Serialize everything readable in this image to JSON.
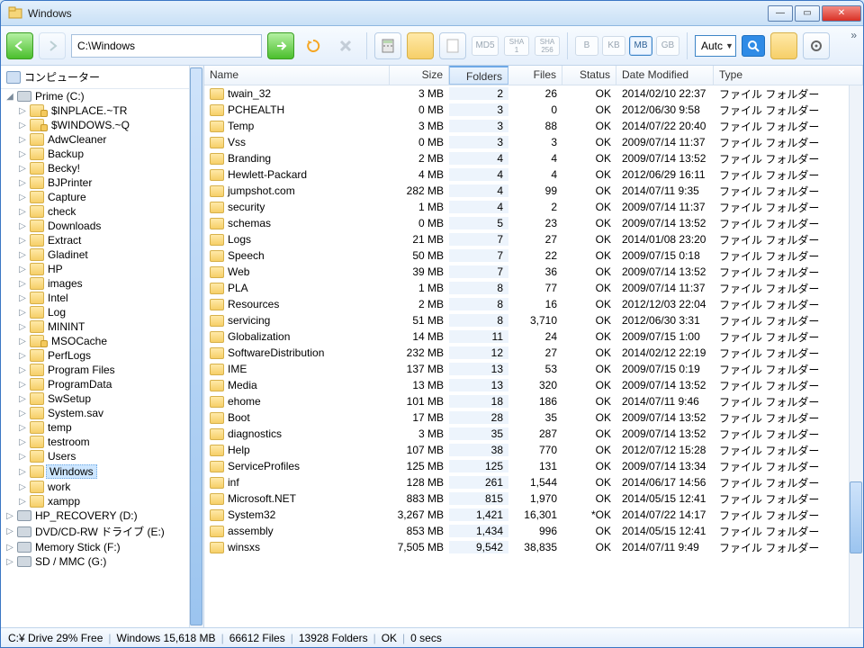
{
  "window": {
    "title": "Windows"
  },
  "toolbar": {
    "path": "C:\\Windows",
    "hash_md5": "MD5",
    "hash_sha1": "SHA\n1",
    "hash_sha256": "SHA\n256",
    "units": [
      "B",
      "KB",
      "MB",
      "GB"
    ],
    "unit_selected": 2,
    "auto": "Autc"
  },
  "tree": {
    "root": "コンピューター",
    "prime": "Prime (C:)",
    "items": [
      {
        "label": "$INPLACE.~TR",
        "locked": true
      },
      {
        "label": "$WINDOWS.~Q",
        "locked": true
      },
      {
        "label": "AdwCleaner"
      },
      {
        "label": "Backup"
      },
      {
        "label": "Becky!"
      },
      {
        "label": "BJPrinter"
      },
      {
        "label": "Capture"
      },
      {
        "label": "check"
      },
      {
        "label": "Downloads"
      },
      {
        "label": "Extract"
      },
      {
        "label": "Gladinet"
      },
      {
        "label": "HP"
      },
      {
        "label": "images"
      },
      {
        "label": "Intel"
      },
      {
        "label": "Log"
      },
      {
        "label": "MININT"
      },
      {
        "label": "MSOCache",
        "locked": true
      },
      {
        "label": "PerfLogs"
      },
      {
        "label": "Program Files"
      },
      {
        "label": "ProgramData"
      },
      {
        "label": "SwSetup"
      },
      {
        "label": "System.sav"
      },
      {
        "label": "temp"
      },
      {
        "label": "testroom"
      },
      {
        "label": "Users"
      },
      {
        "label": "Windows",
        "selected": true
      },
      {
        "label": "work"
      },
      {
        "label": "xampp"
      }
    ],
    "drives": [
      {
        "label": "HP_RECOVERY (D:)"
      },
      {
        "label": "DVD/CD-RW ドライブ (E:)"
      },
      {
        "label": "Memory Stick (F:)"
      },
      {
        "label": "SD / MMC (G:)"
      }
    ]
  },
  "columns": {
    "name": "Name",
    "size": "Size",
    "folders": "Folders",
    "files": "Files",
    "status": "Status",
    "date": "Date Modified",
    "type": "Type"
  },
  "type_label": "ファイル フォルダー",
  "rows": [
    {
      "n": "twain_32",
      "s": "3 MB",
      "fo": "2",
      "fi": "26",
      "st": "OK",
      "d": "2014/02/10 22:37"
    },
    {
      "n": "PCHEALTH",
      "s": "0 MB",
      "fo": "3",
      "fi": "0",
      "st": "OK",
      "d": "2012/06/30 9:58"
    },
    {
      "n": "Temp",
      "s": "3 MB",
      "fo": "3",
      "fi": "88",
      "st": "OK",
      "d": "2014/07/22 20:40"
    },
    {
      "n": "Vss",
      "s": "0 MB",
      "fo": "3",
      "fi": "3",
      "st": "OK",
      "d": "2009/07/14 11:37"
    },
    {
      "n": "Branding",
      "s": "2 MB",
      "fo": "4",
      "fi": "4",
      "st": "OK",
      "d": "2009/07/14 13:52"
    },
    {
      "n": "Hewlett-Packard",
      "s": "4 MB",
      "fo": "4",
      "fi": "4",
      "st": "OK",
      "d": "2012/06/29 16:11"
    },
    {
      "n": "jumpshot.com",
      "s": "282 MB",
      "fo": "4",
      "fi": "99",
      "st": "OK",
      "d": "2014/07/11 9:35"
    },
    {
      "n": "security",
      "s": "1 MB",
      "fo": "4",
      "fi": "2",
      "st": "OK",
      "d": "2009/07/14 11:37"
    },
    {
      "n": "schemas",
      "s": "0 MB",
      "fo": "5",
      "fi": "23",
      "st": "OK",
      "d": "2009/07/14 13:52"
    },
    {
      "n": "Logs",
      "s": "21 MB",
      "fo": "7",
      "fi": "27",
      "st": "OK",
      "d": "2014/01/08 23:20"
    },
    {
      "n": "Speech",
      "s": "50 MB",
      "fo": "7",
      "fi": "22",
      "st": "OK",
      "d": "2009/07/15 0:18"
    },
    {
      "n": "Web",
      "s": "39 MB",
      "fo": "7",
      "fi": "36",
      "st": "OK",
      "d": "2009/07/14 13:52"
    },
    {
      "n": "PLA",
      "s": "1 MB",
      "fo": "8",
      "fi": "77",
      "st": "OK",
      "d": "2009/07/14 11:37"
    },
    {
      "n": "Resources",
      "s": "2 MB",
      "fo": "8",
      "fi": "16",
      "st": "OK",
      "d": "2012/12/03 22:04"
    },
    {
      "n": "servicing",
      "s": "51 MB",
      "fo": "8",
      "fi": "3,710",
      "st": "OK",
      "d": "2012/06/30 3:31"
    },
    {
      "n": "Globalization",
      "s": "14 MB",
      "fo": "11",
      "fi": "24",
      "st": "OK",
      "d": "2009/07/15 1:00"
    },
    {
      "n": "SoftwareDistribution",
      "s": "232 MB",
      "fo": "12",
      "fi": "27",
      "st": "OK",
      "d": "2014/02/12 22:19"
    },
    {
      "n": "IME",
      "s": "137 MB",
      "fo": "13",
      "fi": "53",
      "st": "OK",
      "d": "2009/07/15 0:19"
    },
    {
      "n": "Media",
      "s": "13 MB",
      "fo": "13",
      "fi": "320",
      "st": "OK",
      "d": "2009/07/14 13:52"
    },
    {
      "n": "ehome",
      "s": "101 MB",
      "fo": "18",
      "fi": "186",
      "st": "OK",
      "d": "2014/07/11 9:46"
    },
    {
      "n": "Boot",
      "s": "17 MB",
      "fo": "28",
      "fi": "35",
      "st": "OK",
      "d": "2009/07/14 13:52"
    },
    {
      "n": "diagnostics",
      "s": "3 MB",
      "fo": "35",
      "fi": "287",
      "st": "OK",
      "d": "2009/07/14 13:52"
    },
    {
      "n": "Help",
      "s": "107 MB",
      "fo": "38",
      "fi": "770",
      "st": "OK",
      "d": "2012/07/12 15:28"
    },
    {
      "n": "ServiceProfiles",
      "s": "125 MB",
      "fo": "125",
      "fi": "131",
      "st": "OK",
      "d": "2009/07/14 13:34"
    },
    {
      "n": "inf",
      "s": "128 MB",
      "fo": "261",
      "fi": "1,544",
      "st": "OK",
      "d": "2014/06/17 14:56"
    },
    {
      "n": "Microsoft.NET",
      "s": "883 MB",
      "fo": "815",
      "fi": "1,970",
      "st": "OK",
      "d": "2014/05/15 12:41"
    },
    {
      "n": "System32",
      "s": "3,267 MB",
      "fo": "1,421",
      "fi": "16,301",
      "st": "*OK",
      "d": "2014/07/22 14:17"
    },
    {
      "n": "assembly",
      "s": "853 MB",
      "fo": "1,434",
      "fi": "996",
      "st": "OK",
      "d": "2014/05/15 12:41"
    },
    {
      "n": "winsxs",
      "s": "7,505 MB",
      "fo": "9,542",
      "fi": "38,835",
      "st": "OK",
      "d": "2014/07/11 9:49"
    }
  ],
  "status": {
    "drive": "C:¥ Drive 29% Free",
    "size": "Windows 15,618  MB",
    "files": "66612 Files",
    "folders": "13928 Folders",
    "ok": "OK",
    "secs": "0 secs"
  }
}
